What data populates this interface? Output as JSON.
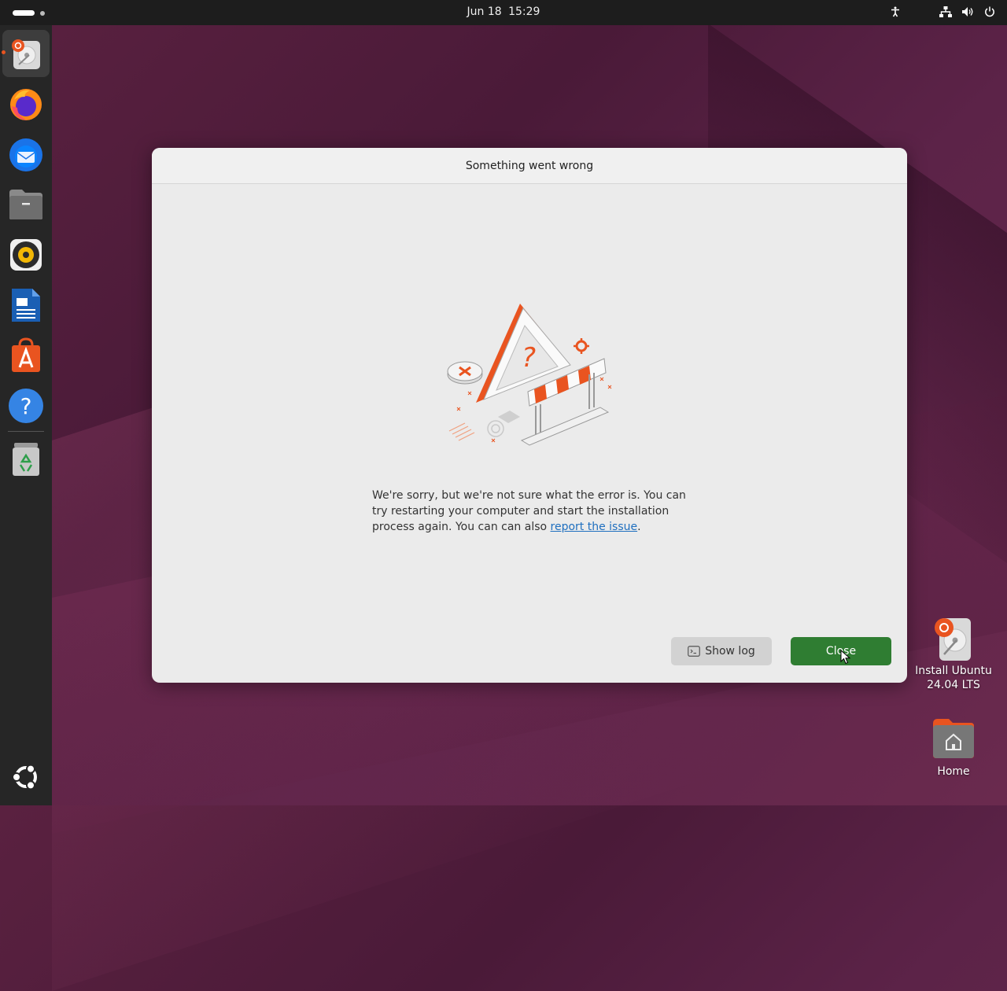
{
  "topbar": {
    "date": "Jun 18",
    "time": "15:29",
    "tray_icons": [
      "accessibility-icon",
      "network-icon",
      "volume-icon",
      "power-icon"
    ]
  },
  "dock": {
    "items": [
      {
        "name": "Install Ubuntu",
        "icon": "installer-icon",
        "active": true
      },
      {
        "name": "Firefox",
        "icon": "firefox-icon"
      },
      {
        "name": "Thunderbird",
        "icon": "thunderbird-icon"
      },
      {
        "name": "Files",
        "icon": "files-icon"
      },
      {
        "name": "Rhythmbox",
        "icon": "rhythmbox-icon"
      },
      {
        "name": "LibreOffice Writer",
        "icon": "writer-icon"
      },
      {
        "name": "App Center",
        "icon": "app-center-icon"
      },
      {
        "name": "Help",
        "icon": "help-icon"
      },
      {
        "name": "Trash",
        "icon": "trash-icon"
      },
      {
        "name": "Show Apps",
        "icon": "ubuntu-logo-icon"
      }
    ]
  },
  "dialog": {
    "title": "Something went wrong",
    "message_text": "We're sorry, but we're not sure what the error is. You can try restarting your computer and start the installation process again. You can can also ",
    "message_link": "report the issue",
    "message_end": ".",
    "show_log_label": "Show log",
    "close_label": "Close",
    "accent_color": "#2f7d32",
    "illustration_color": "#e95420"
  },
  "desktop": {
    "install_label_1": "Install Ubuntu",
    "install_label_2": "24.04 LTS",
    "home_label": "Home"
  }
}
